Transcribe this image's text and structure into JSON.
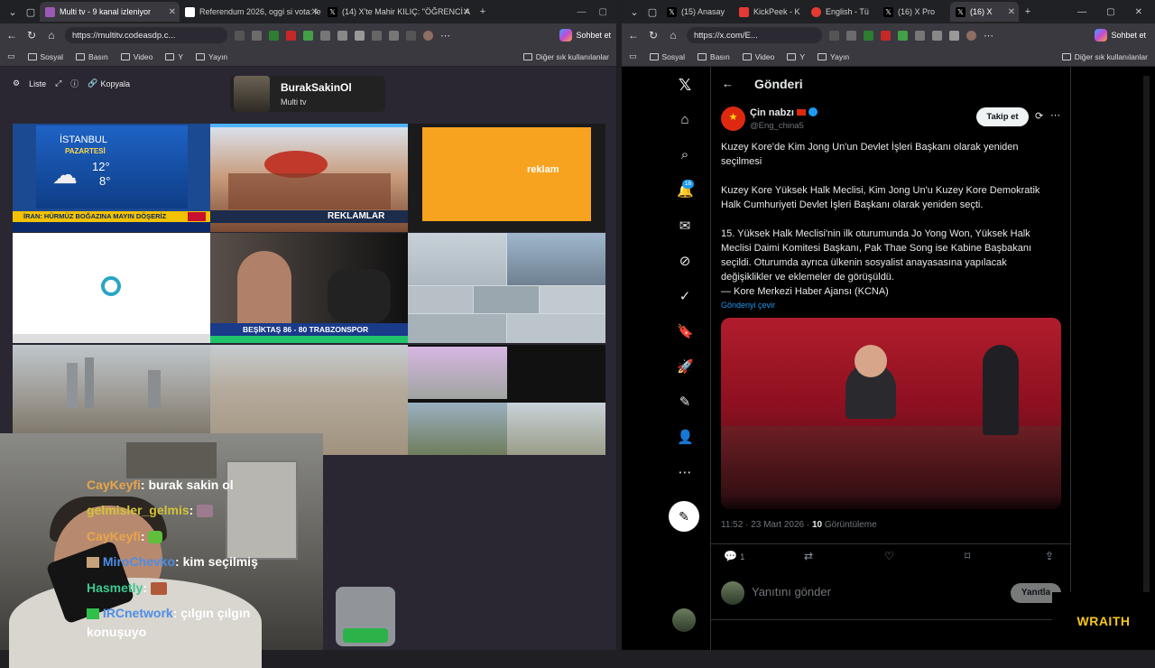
{
  "left_window": {
    "tabs": [
      {
        "label": "Multi tv - 9 kanal izleniyor",
        "active": true
      },
      {
        "label": "Referendum 2026, oggi si vota: le"
      },
      {
        "label": "(14) X'te Mahir KILIÇ: \"ÖĞRENCİ A"
      }
    ],
    "url": "https://multitv.codeasdp.c...",
    "bookmarks": [
      "Sosyal",
      "Basın",
      "Video",
      "Y",
      "Yayın"
    ],
    "bookmarks_other": "Diğer sık kullanılanlar",
    "sohbet": "Sohbet et"
  },
  "multitv": {
    "toolbar": {
      "list": "Liste",
      "copy": "Kopyala"
    },
    "profile": {
      "name": "BurakSakinOl",
      "subtitle": "Multi tv"
    },
    "tiles": {
      "istanbul": "İSTANBUL",
      "day": "PAZARTESİ",
      "temp_high": "12°",
      "temp_low": "8°",
      "ticker1": "İRAN: HÜRMÜZ BOĞAZINA MAYIN DÖŞERİZ",
      "ad_label": "REKLAMLAR",
      "reklam": "reklam",
      "score": "BEŞİKTAŞ 86 - 80 TRABZONSPOR"
    }
  },
  "chat": [
    {
      "user": "CayKeyfi",
      "text": "burak sakin ol",
      "color": "#e8a54a"
    },
    {
      "user": "gelmisler_gelmis",
      "text": "",
      "color": "#d4c23a"
    },
    {
      "user": "CayKeyfi",
      "text": "",
      "color": "#e8a54a"
    },
    {
      "user": "MiroChevko",
      "text": "kim seçilmiş",
      "color": "#4d8ee8"
    },
    {
      "user": "Hasmetly",
      "text": "",
      "color": "#3ac98f"
    },
    {
      "user": "IRCnetwork",
      "text": "çılgın çılgın",
      "color": "#4d8ee8"
    }
  ],
  "chat_tail": "konuşuyo",
  "right_window": {
    "tabs": [
      {
        "label": "(15) Anasay"
      },
      {
        "label": "KickPeek - K"
      },
      {
        "label": "English - Tü"
      },
      {
        "label": "(16) X Pro"
      },
      {
        "label": "(16) X",
        "active": true
      }
    ],
    "url": "https://x.com/E...",
    "bookmarks": [
      "Sosyal",
      "Basın",
      "Video",
      "Y",
      "Yayın"
    ],
    "bookmarks_other": "Diğer sık kullanılanlar",
    "sohbet": "Sohbet et"
  },
  "tweet": {
    "header": "Gönderi",
    "name": "Çin nabzı",
    "handle": "@Eng_china5",
    "follow": "Takip et",
    "notif_count": "16",
    "p1": "Kuzey Kore'de Kim Jong Un'un Devlet İşleri Başkanı olarak yeniden seçilmesi",
    "p2": "Kuzey Kore Yüksek Halk Meclisi, Kim Jong Un'u Kuzey Kore Demokratik Halk Cumhuriyeti Devlet İşleri Başkanı olarak yeniden seçti.",
    "p3": "15. Yüksek Halk Meclisi'nin ilk oturumunda Jo Yong Won, Yüksek Halk Meclisi Daimi Komitesi Başkanı, Pak Thae Song ise Kabine Başbakanı seçildi. Oturumda ayrıca ülkenin sosyalist anayasasına yapılacak değişiklikler ve eklemeler de görüşüldü.",
    "p4": "— Kore Merkezi Haber Ajansı (KCNA)",
    "translate": "Gönderiyi çevir",
    "time": "11:52 · 23 Mart 2026 ·",
    "views_count": "10",
    "views_label": "Görüntüleme",
    "replies": "1",
    "reply_placeholder": "Yanıtını gönder",
    "reply_button": "Yanıtla"
  },
  "overlay_brand": "WRAITH",
  "colors": {
    "x_blue": "#1d9bf0",
    "cnn_red": "#c8102e"
  }
}
